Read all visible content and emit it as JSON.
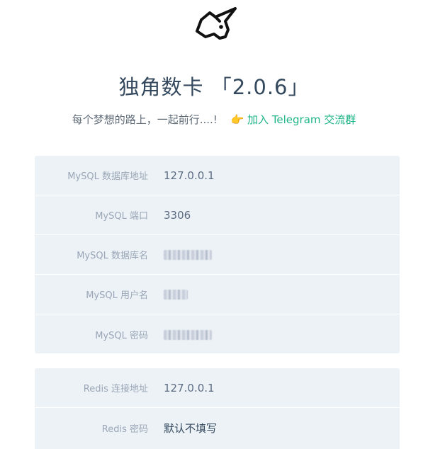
{
  "header": {
    "logo_icon": "unicorn-icon",
    "title": "独角数卡 「2.0.6」",
    "subtitle_text": "每个梦想的路上，一起前行....!",
    "hand_icon": "👉",
    "telegram_link": "加入 Telegram 交流群"
  },
  "mysql": {
    "rows": [
      {
        "label": "MySQL 数据库地址",
        "value": "127.0.0.1"
      },
      {
        "label": "MySQL 端口",
        "value": "3306"
      },
      {
        "label": "MySQL 数据库名",
        "value": ""
      },
      {
        "label": "MySQL 用户名",
        "value": ""
      },
      {
        "label": "MySQL 密码",
        "value": ""
      }
    ]
  },
  "redis": {
    "rows": [
      {
        "label": "Redis 连接地址",
        "value": "127.0.0.1"
      },
      {
        "label": "Redis 密码",
        "value": "默认不填写"
      }
    ]
  },
  "colors": {
    "accent": "#1eb486",
    "title": "#34495e",
    "card_bg": "#edf2f6",
    "label": "#9aa6b7"
  }
}
